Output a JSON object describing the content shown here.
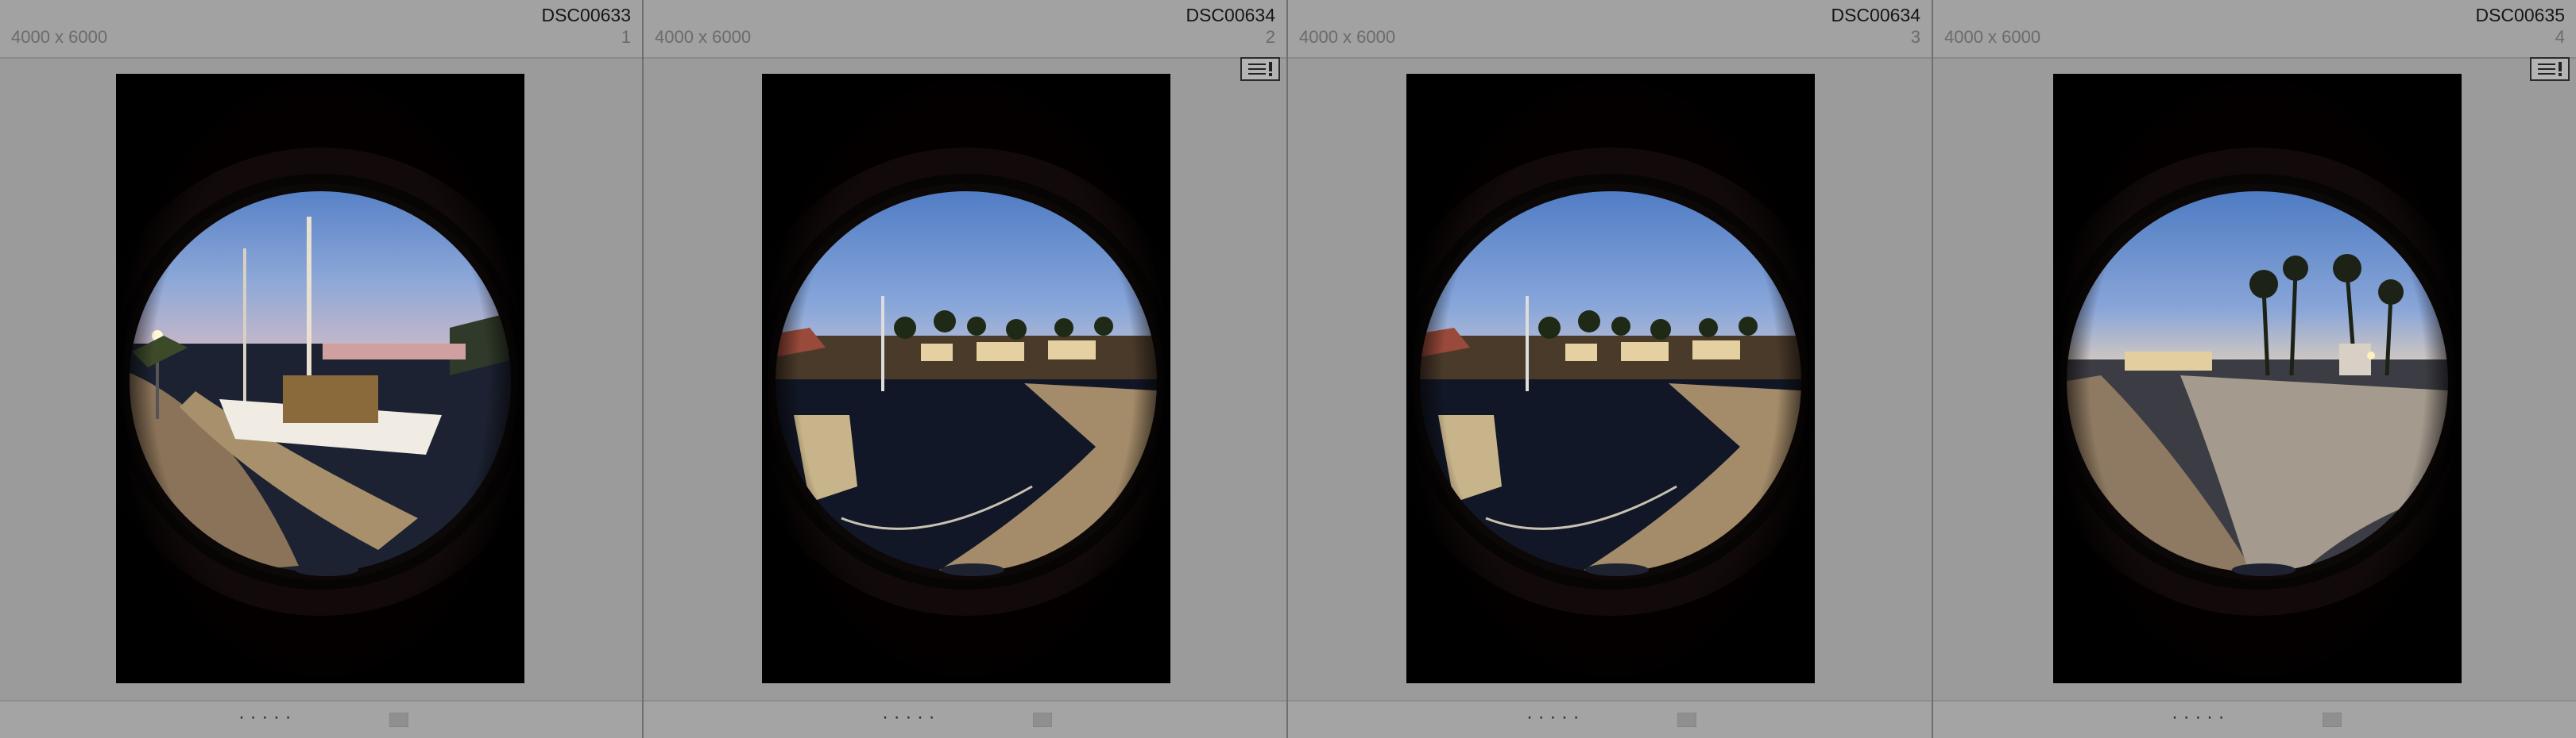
{
  "thumbnails": [
    {
      "filename": "DSC00633",
      "dimensions": "4000 x 6000",
      "index": "1",
      "rating_dots": "· · · · ·",
      "has_badge": false,
      "scene": "sailboat"
    },
    {
      "filename": "DSC00634",
      "dimensions": "4000 x 6000",
      "index": "2",
      "rating_dots": "· · · · ·",
      "has_badge": true,
      "scene": "harbor"
    },
    {
      "filename": "DSC00634",
      "dimensions": "4000 x 6000",
      "index": "3",
      "rating_dots": "· · · · ·",
      "has_badge": false,
      "scene": "harbor"
    },
    {
      "filename": "DSC00635",
      "dimensions": "4000 x 6000",
      "index": "4",
      "rating_dots": "· · · · ·",
      "has_badge": true,
      "scene": "promenade"
    }
  ],
  "icons": {
    "badge": "metadata-warning-icon",
    "color_label": "color-label-icon"
  },
  "colors": {
    "background": "#9b9b9b",
    "header": "#a2a2a2",
    "photo_frame": "#050000",
    "sky": "#5a86c9"
  }
}
